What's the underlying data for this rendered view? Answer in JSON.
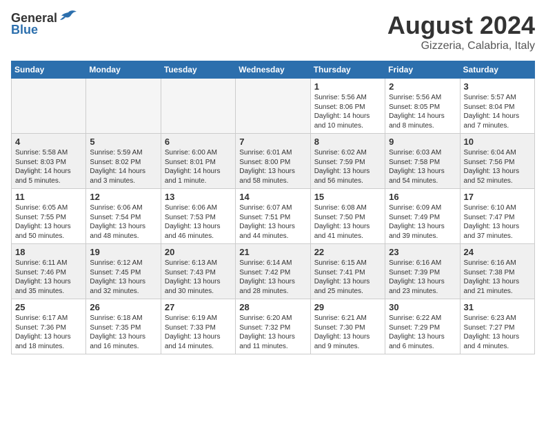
{
  "header": {
    "logo_general": "General",
    "logo_blue": "Blue",
    "title": "August 2024",
    "subtitle": "Gizzeria, Calabria, Italy"
  },
  "weekdays": [
    "Sunday",
    "Monday",
    "Tuesday",
    "Wednesday",
    "Thursday",
    "Friday",
    "Saturday"
  ],
  "weeks": [
    [
      {
        "day": "",
        "info": ""
      },
      {
        "day": "",
        "info": ""
      },
      {
        "day": "",
        "info": ""
      },
      {
        "day": "",
        "info": ""
      },
      {
        "day": "1",
        "info": "Sunrise: 5:56 AM\nSunset: 8:06 PM\nDaylight: 14 hours\nand 10 minutes."
      },
      {
        "day": "2",
        "info": "Sunrise: 5:56 AM\nSunset: 8:05 PM\nDaylight: 14 hours\nand 8 minutes."
      },
      {
        "day": "3",
        "info": "Sunrise: 5:57 AM\nSunset: 8:04 PM\nDaylight: 14 hours\nand 7 minutes."
      }
    ],
    [
      {
        "day": "4",
        "info": "Sunrise: 5:58 AM\nSunset: 8:03 PM\nDaylight: 14 hours\nand 5 minutes."
      },
      {
        "day": "5",
        "info": "Sunrise: 5:59 AM\nSunset: 8:02 PM\nDaylight: 14 hours\nand 3 minutes."
      },
      {
        "day": "6",
        "info": "Sunrise: 6:00 AM\nSunset: 8:01 PM\nDaylight: 14 hours\nand 1 minute."
      },
      {
        "day": "7",
        "info": "Sunrise: 6:01 AM\nSunset: 8:00 PM\nDaylight: 13 hours\nand 58 minutes."
      },
      {
        "day": "8",
        "info": "Sunrise: 6:02 AM\nSunset: 7:59 PM\nDaylight: 13 hours\nand 56 minutes."
      },
      {
        "day": "9",
        "info": "Sunrise: 6:03 AM\nSunset: 7:58 PM\nDaylight: 13 hours\nand 54 minutes."
      },
      {
        "day": "10",
        "info": "Sunrise: 6:04 AM\nSunset: 7:56 PM\nDaylight: 13 hours\nand 52 minutes."
      }
    ],
    [
      {
        "day": "11",
        "info": "Sunrise: 6:05 AM\nSunset: 7:55 PM\nDaylight: 13 hours\nand 50 minutes."
      },
      {
        "day": "12",
        "info": "Sunrise: 6:06 AM\nSunset: 7:54 PM\nDaylight: 13 hours\nand 48 minutes."
      },
      {
        "day": "13",
        "info": "Sunrise: 6:06 AM\nSunset: 7:53 PM\nDaylight: 13 hours\nand 46 minutes."
      },
      {
        "day": "14",
        "info": "Sunrise: 6:07 AM\nSunset: 7:51 PM\nDaylight: 13 hours\nand 44 minutes."
      },
      {
        "day": "15",
        "info": "Sunrise: 6:08 AM\nSunset: 7:50 PM\nDaylight: 13 hours\nand 41 minutes."
      },
      {
        "day": "16",
        "info": "Sunrise: 6:09 AM\nSunset: 7:49 PM\nDaylight: 13 hours\nand 39 minutes."
      },
      {
        "day": "17",
        "info": "Sunrise: 6:10 AM\nSunset: 7:47 PM\nDaylight: 13 hours\nand 37 minutes."
      }
    ],
    [
      {
        "day": "18",
        "info": "Sunrise: 6:11 AM\nSunset: 7:46 PM\nDaylight: 13 hours\nand 35 minutes."
      },
      {
        "day": "19",
        "info": "Sunrise: 6:12 AM\nSunset: 7:45 PM\nDaylight: 13 hours\nand 32 minutes."
      },
      {
        "day": "20",
        "info": "Sunrise: 6:13 AM\nSunset: 7:43 PM\nDaylight: 13 hours\nand 30 minutes."
      },
      {
        "day": "21",
        "info": "Sunrise: 6:14 AM\nSunset: 7:42 PM\nDaylight: 13 hours\nand 28 minutes."
      },
      {
        "day": "22",
        "info": "Sunrise: 6:15 AM\nSunset: 7:41 PM\nDaylight: 13 hours\nand 25 minutes."
      },
      {
        "day": "23",
        "info": "Sunrise: 6:16 AM\nSunset: 7:39 PM\nDaylight: 13 hours\nand 23 minutes."
      },
      {
        "day": "24",
        "info": "Sunrise: 6:16 AM\nSunset: 7:38 PM\nDaylight: 13 hours\nand 21 minutes."
      }
    ],
    [
      {
        "day": "25",
        "info": "Sunrise: 6:17 AM\nSunset: 7:36 PM\nDaylight: 13 hours\nand 18 minutes."
      },
      {
        "day": "26",
        "info": "Sunrise: 6:18 AM\nSunset: 7:35 PM\nDaylight: 13 hours\nand 16 minutes."
      },
      {
        "day": "27",
        "info": "Sunrise: 6:19 AM\nSunset: 7:33 PM\nDaylight: 13 hours\nand 14 minutes."
      },
      {
        "day": "28",
        "info": "Sunrise: 6:20 AM\nSunset: 7:32 PM\nDaylight: 13 hours\nand 11 minutes."
      },
      {
        "day": "29",
        "info": "Sunrise: 6:21 AM\nSunset: 7:30 PM\nDaylight: 13 hours\nand 9 minutes."
      },
      {
        "day": "30",
        "info": "Sunrise: 6:22 AM\nSunset: 7:29 PM\nDaylight: 13 hours\nand 6 minutes."
      },
      {
        "day": "31",
        "info": "Sunrise: 6:23 AM\nSunset: 7:27 PM\nDaylight: 13 hours\nand 4 minutes."
      }
    ]
  ]
}
